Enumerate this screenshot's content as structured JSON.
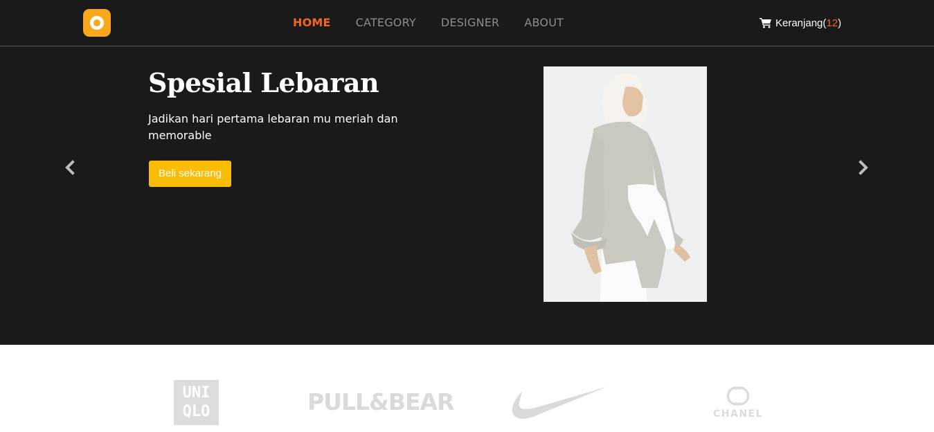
{
  "header": {
    "logo_icon": "ring-logo-icon",
    "nav": [
      {
        "label": "HOME",
        "active": true
      },
      {
        "label": "CATEGORY",
        "active": false
      },
      {
        "label": "DESIGNER",
        "active": false
      },
      {
        "label": "ABOUT",
        "active": false
      }
    ],
    "cart": {
      "icon": "shopping-cart-icon",
      "label": "Keranjang",
      "open": "(",
      "count": "12",
      "close": ")"
    }
  },
  "hero": {
    "title": "Spesial Lebaran",
    "subtitle": "Jadikan hari pertama lebaran mu meriah dan memorable",
    "button_label": "Beli sekarang",
    "prev_icon": "chevron-left-icon",
    "next_icon": "chevron-right-icon",
    "image": "hijab-model-photo"
  },
  "brands": {
    "uniqlo": [
      "UNI",
      "QLO"
    ],
    "pullbear": "PULL&BEAR",
    "nike": "nike-swoosh-logo",
    "chanel": "CHANEL"
  },
  "colors": {
    "background_dark": "#1b1a1b",
    "accent_orange": "#f26522",
    "button_yellow": "#fbbc05",
    "logo_yellow": "#f9a81b"
  }
}
